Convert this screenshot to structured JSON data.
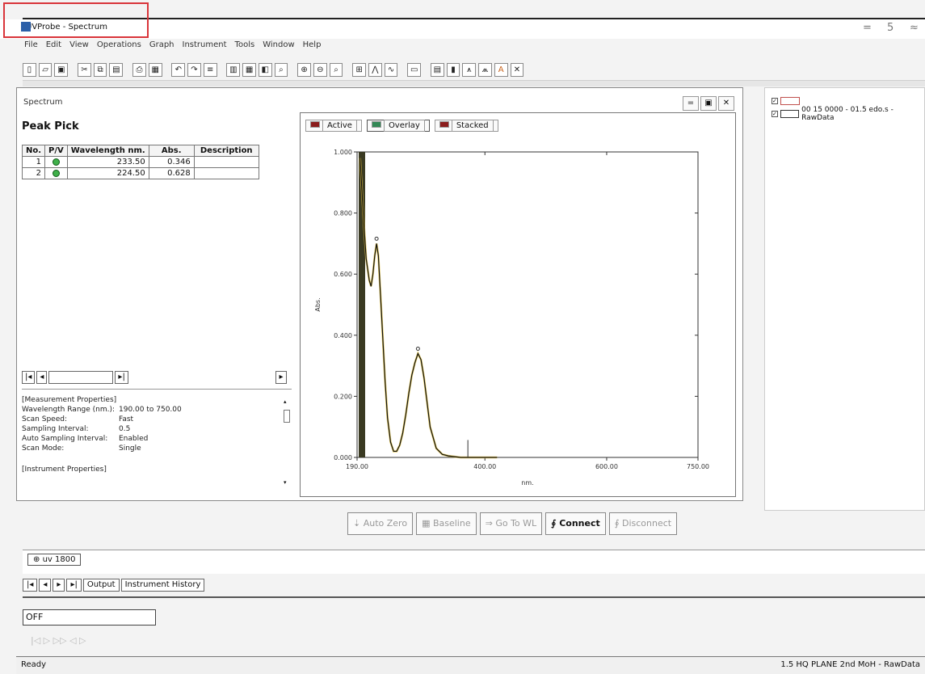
{
  "window": {
    "title": "UVProbe - Spectrum",
    "controls": [
      "=",
      "5",
      "≈"
    ]
  },
  "menu": [
    "File",
    "Edit",
    "View",
    "Operations",
    "Graph",
    "Instrument",
    "Tools",
    "Window",
    "Help"
  ],
  "spectrum_window": {
    "title": "Spectrum",
    "controls": [
      "=",
      "▣",
      "✕"
    ]
  },
  "peak_pick": {
    "title": "Peak Pick",
    "headers": [
      "No.",
      "P/V",
      "Wavelength nm.",
      "Abs.",
      "Description"
    ],
    "rows": [
      {
        "no": "1",
        "wavelength": "233.50",
        "abs": "0.346",
        "description": ""
      },
      {
        "no": "2",
        "wavelength": "224.50",
        "abs": "0.628",
        "description": ""
      }
    ]
  },
  "properties": {
    "measurement_header": "[Measurement Properties]",
    "rows": [
      {
        "k": "Wavelength Range (nm.):",
        "v": "190.00 to 750.00"
      },
      {
        "k": "Scan Speed:",
        "v": "Fast"
      },
      {
        "k": "Sampling Interval:",
        "v": "0.5"
      },
      {
        "k": "Auto Sampling Interval:",
        "v": "Enabled"
      },
      {
        "k": "Scan Mode:",
        "v": "Single"
      }
    ],
    "instrument_header": "[Instrument Properties]"
  },
  "chart_tabs": [
    "Active",
    "Overlay",
    "Stacked"
  ],
  "chart_data": {
    "type": "line",
    "xlabel": "nm.",
    "ylabel": "Abs.",
    "xlim": [
      190,
      750
    ],
    "ylim": [
      0,
      1
    ],
    "x_ticks": [
      "190.00",
      "400.00",
      "600.00",
      "750.00"
    ],
    "y_ticks": [
      "0.000",
      "0.200",
      "0.400",
      "0.600",
      "0.800",
      "1.000"
    ],
    "series": [
      {
        "name": "",
        "color": "#111111",
        "x": [
          195,
          200,
          205,
          210,
          213,
          216,
          219,
          222,
          225,
          228,
          232,
          236,
          240,
          245,
          250,
          255,
          260,
          265,
          270,
          275,
          280,
          285,
          290,
          295,
          300,
          305,
          310,
          320,
          330,
          340,
          360,
          380,
          400,
          420
        ],
        "y": [
          0.98,
          0.8,
          0.65,
          0.58,
          0.56,
          0.6,
          0.66,
          0.7,
          0.66,
          0.55,
          0.4,
          0.25,
          0.13,
          0.05,
          0.02,
          0.02,
          0.04,
          0.08,
          0.14,
          0.21,
          0.27,
          0.31,
          0.34,
          0.32,
          0.26,
          0.18,
          0.1,
          0.03,
          0.01,
          0.005,
          0.0,
          0.0,
          0.0,
          0.0
        ]
      }
    ],
    "spike": {
      "x": 372,
      "y": 0.02
    }
  },
  "right_panel": {
    "items": [
      "",
      "00 15 0000 - 01.5 edo.s - RawData"
    ]
  },
  "actions": [
    "Auto Zero",
    "Baseline",
    "Go To WL",
    "Connect",
    "Disconnect"
  ],
  "lower": {
    "tab_label": "uv 1800",
    "output_tabs": [
      "Output",
      "Instrument History"
    ],
    "status_value": "OFF",
    "faded_controls": "|◁ ▷ ▷▷   ◁ ▷"
  },
  "statusbar": {
    "left": "Ready",
    "right": "1.5 HQ PLANE 2nd MoH - RawData"
  }
}
